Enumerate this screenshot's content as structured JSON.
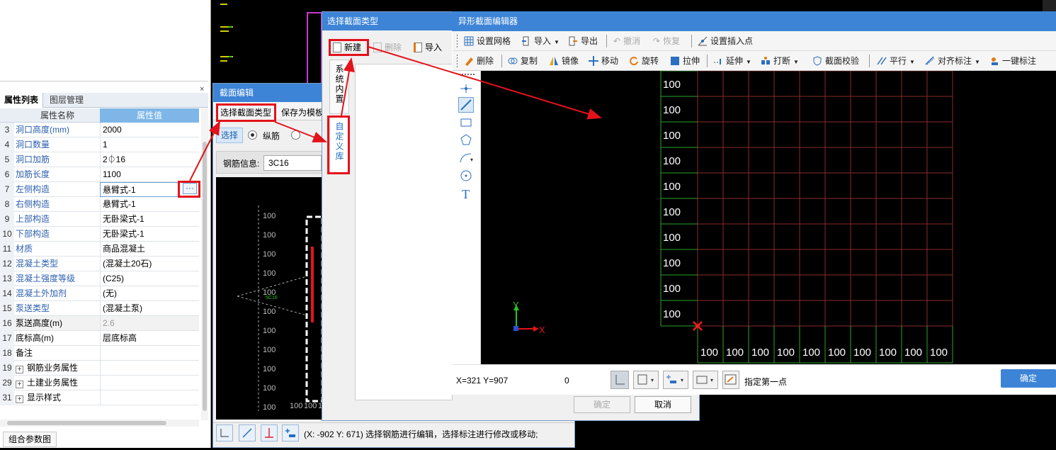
{
  "left_panel": {
    "tab_props": "属性列表",
    "tab_layers": "图层管理",
    "header_name": "属性名称",
    "header_value": "属性值",
    "close_icon": "×",
    "rows": [
      {
        "num": "3",
        "name": "洞口高度(mm)",
        "value": "2000",
        "blue": true
      },
      {
        "num": "4",
        "name": "洞口数量",
        "value": "1",
        "blue": true
      },
      {
        "num": "5",
        "name": "洞口加筋",
        "value": "2⏀16",
        "blue": true
      },
      {
        "num": "6",
        "name": "加筋长度",
        "value": "1100",
        "blue": true
      },
      {
        "num": "7",
        "name": "左侧构造",
        "value": "悬臂式-1",
        "blue": true
      },
      {
        "num": "8",
        "name": "右侧构造",
        "value": "悬臂式-1",
        "blue": true
      },
      {
        "num": "9",
        "name": "上部构造",
        "value": "无卧梁式-1",
        "blue": true
      },
      {
        "num": "10",
        "name": "下部构造",
        "value": "无卧梁式-1",
        "blue": true
      },
      {
        "num": "11",
        "name": "材质",
        "value": "商品混凝土",
        "blue": true
      },
      {
        "num": "12",
        "name": "混凝土类型",
        "value": "(混凝土20石)",
        "blue": true
      },
      {
        "num": "13",
        "name": "混凝土强度等级",
        "value": "(C25)",
        "blue": true
      },
      {
        "num": "14",
        "name": "混凝土外加剂",
        "value": "(无)",
        "blue": true
      },
      {
        "num": "15",
        "name": "泵送类型",
        "value": "(混凝土泵)",
        "blue": true
      },
      {
        "num": "16",
        "name": "泵送高度(m)",
        "value": "2.6",
        "blue": false
      },
      {
        "num": "17",
        "name": "底标高(m)",
        "value": "层底标高",
        "blue": false
      },
      {
        "num": "18",
        "name": "备注",
        "value": "",
        "blue": false
      },
      {
        "num": "19",
        "name": "钢筋业务属性",
        "value": "",
        "blue": false,
        "expand": true
      },
      {
        "num": "29",
        "name": "土建业务属性",
        "value": "",
        "blue": false,
        "expand": true
      },
      {
        "num": "31",
        "name": "显示样式",
        "value": "",
        "blue": false,
        "expand": true
      }
    ],
    "combo_button": "组合参数图",
    "more_button": "···"
  },
  "section_dialog": {
    "title": "截面编辑",
    "tab_select": "选择截面类型",
    "tab_save": "保存为模板",
    "select_button": "选择",
    "radio_longitudinal": "纵筋",
    "rebar_label": "钢筋信息:",
    "rebar_value": "3C16",
    "status_text": "(X: -902 Y: 671)  选择钢筋进行编辑，选择标注进行修改或移动;",
    "cad_labels": [
      "100",
      "100",
      "100",
      "100",
      "100",
      "100",
      "100",
      "100",
      "100",
      "100",
      "100"
    ],
    "cad_bottom": [
      "100",
      "100",
      "100"
    ],
    "cad_small": "5C16"
  },
  "type_dialog": {
    "title": "选择截面类型",
    "new_button": "新建",
    "delete_button": "删除",
    "import_button": "导入",
    "side_system": "系统内置",
    "side_custom": "自定义库",
    "ok_button": "确定",
    "cancel_button": "取消"
  },
  "shape_editor": {
    "title": "异形截面编辑器",
    "toolbar1": {
      "grid": "设置网格",
      "import": "导入",
      "export": "导出",
      "undo": "撤消",
      "redo": "恢复",
      "insert_point": "设置插入点"
    },
    "toolbar2": {
      "delete": "删除",
      "copy": "复制",
      "mirror": "镜像",
      "move": "移动",
      "rotate": "旋转",
      "stretch": "拉伸",
      "extend": "延伸",
      "break": "打断",
      "check": "截面校验",
      "parallel": "平行",
      "align_dim": "对齐标注",
      "one_click": "一键标注"
    },
    "left_grid_labels": [
      "100",
      "100",
      "100",
      "100",
      "100",
      "100",
      "100",
      "100",
      "100",
      "100"
    ],
    "bottom_grid_labels": [
      "100",
      "100",
      "100",
      "100",
      "100",
      "100",
      "100",
      "100",
      "100",
      "100"
    ],
    "axis_y": "Y",
    "axis_x": "X",
    "coords": "X=321 Y=907",
    "zero": "0",
    "hint": "指定第一点",
    "confirm": "确定"
  },
  "colors": {
    "title_blue": "#3d84d6",
    "annotation_red": "#e3121b",
    "grid_red": "#8b2a2a",
    "grid_green": "#2aa52a"
  }
}
